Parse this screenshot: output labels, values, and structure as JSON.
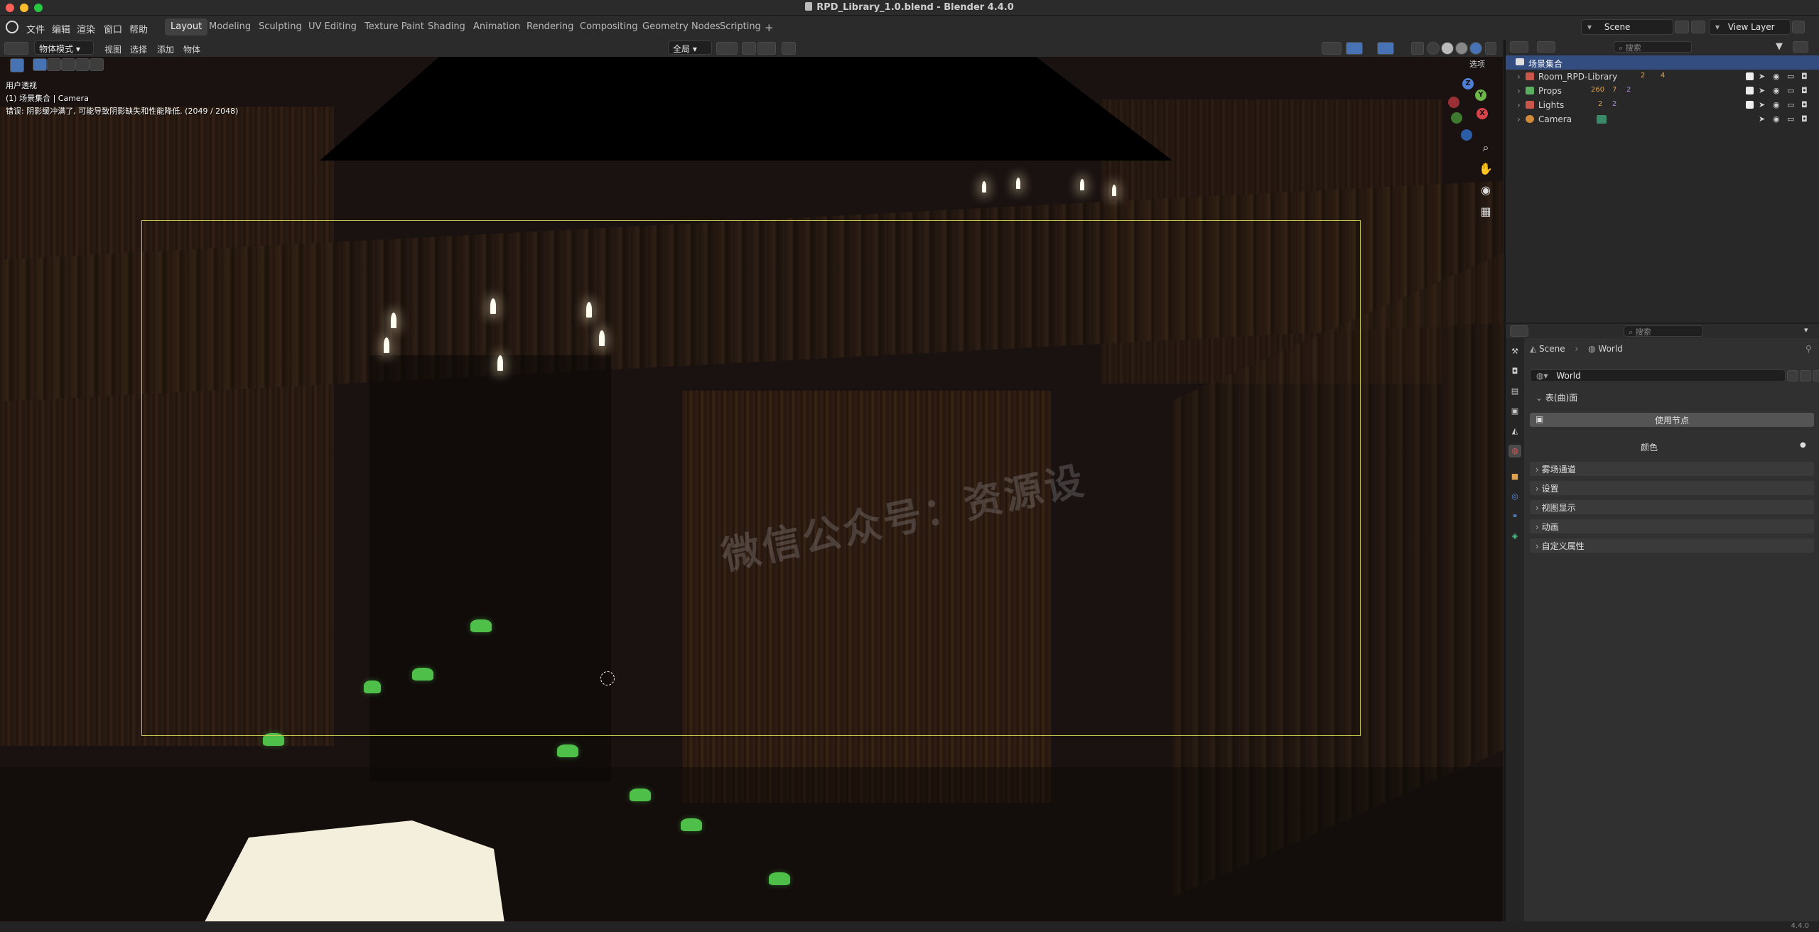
{
  "window": {
    "title": "RPD_Library_1.0.blend - Blender 4.4.0",
    "traffic_colors": [
      "#fe5f57",
      "#febc2e",
      "#28c840"
    ]
  },
  "menu": [
    "文件",
    "编辑",
    "渲染",
    "窗口",
    "帮助"
  ],
  "workspaces": [
    "Layout",
    "Modeling",
    "Sculpting",
    "UV Editing",
    "Texture Paint",
    "Shading",
    "Animation",
    "Rendering",
    "Compositing",
    "Geometry Nodes",
    "Scripting"
  ],
  "active_workspace": "Layout",
  "add_workspace": "+",
  "scene": {
    "name": "Scene",
    "view_layer": "View Layer"
  },
  "viewport": {
    "mode": "物体模式",
    "menus": [
      "视图",
      "选择",
      "添加",
      "物体"
    ],
    "transform_orientation": "全局",
    "options_label": "选项",
    "overlay": {
      "line1": "用户透视",
      "line2": "(1) 场景集合 | Camera",
      "line3": "错误: 阴影缓冲满了, 可能导致阴影缺失和性能降低. (2049 / 2048)"
    },
    "watermark": "微信公众号：资源设",
    "gizmo": {
      "z": "Z",
      "y": "Y",
      "x": "X"
    },
    "nav_icons": [
      "zoom-icon",
      "hand-icon",
      "camera-icon",
      "grid-icon"
    ]
  },
  "outliner": {
    "search_placeholder": "搜索",
    "root": "场景集合",
    "items": [
      {
        "name": "Room_RPD-Library",
        "badges": [
          "2",
          "4"
        ],
        "color": "#c8564a"
      },
      {
        "name": "Props",
        "badges": [
          "260",
          "7",
          "2"
        ],
        "color": "#5ab060"
      },
      {
        "name": "Lights",
        "badges": [
          "2",
          "2"
        ],
        "color": "#c8564a"
      },
      {
        "name": "Camera",
        "badges": [],
        "color": "#d08a3a"
      }
    ]
  },
  "properties": {
    "search_placeholder": "搜索",
    "breadcrumb": [
      "Scene",
      "World"
    ],
    "world_name": "World",
    "surface_panel": "表(曲)面",
    "use_nodes": "使用节点",
    "color_label": "颜色",
    "panels": [
      "雾场通道",
      "设置",
      "视图显示",
      "动画",
      "自定义属性"
    ]
  },
  "status": {
    "version": "4.4.0"
  }
}
